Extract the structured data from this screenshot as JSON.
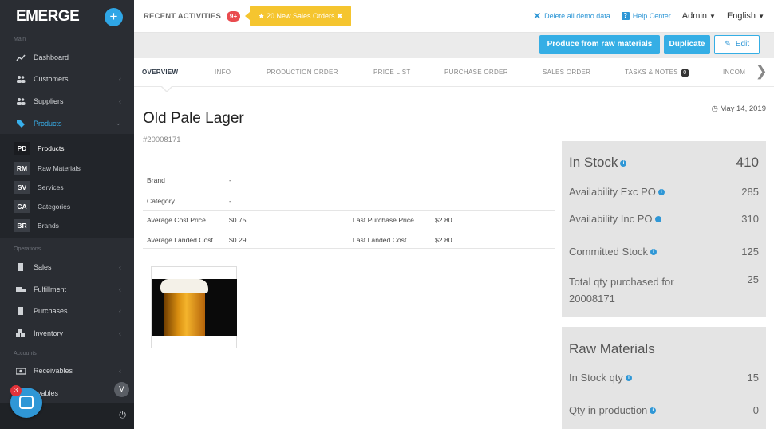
{
  "sidebar": {
    "logo": "EMERGE",
    "add_symbol": "+",
    "section_main": "Main",
    "section_operations": "Operations",
    "section_accounts": "Accounts",
    "items": [
      {
        "label": "Dashboard",
        "icon": "chart-icon"
      },
      {
        "label": "Customers",
        "icon": "users-icon"
      },
      {
        "label": "Suppliers",
        "icon": "users-icon"
      },
      {
        "label": "Products",
        "icon": "tag-icon"
      }
    ],
    "product_sub": [
      {
        "abbr": "PD",
        "label": "Products"
      },
      {
        "abbr": "RM",
        "label": "Raw Materials"
      },
      {
        "abbr": "SV",
        "label": "Services"
      },
      {
        "abbr": "CA",
        "label": "Categories"
      },
      {
        "abbr": "BR",
        "label": "Brands"
      }
    ],
    "ops_items": [
      {
        "label": "Sales"
      },
      {
        "label": "Fulfillment"
      },
      {
        "label": "Purchases"
      },
      {
        "label": "Inventory"
      }
    ],
    "acct_items": [
      {
        "label": "Receivables"
      },
      {
        "label": "ayables"
      }
    ],
    "chat_badge": "3",
    "collapse_symbol": "V"
  },
  "topbar": {
    "recent_label": "RECENT ACTIVITIES",
    "recent_badge": "9+",
    "alert_label": "20 New Sales Orders",
    "delete_demo": "Delete all demo data",
    "help": "Help Center",
    "user": "Admin",
    "language": "English"
  },
  "actions": {
    "produce": "Produce from raw materials",
    "duplicate": "Duplicate",
    "edit": "Edit"
  },
  "tabs": [
    "OVERVIEW",
    "INFO",
    "PRODUCTION ORDER",
    "PRICE LIST",
    "PURCHASE ORDER",
    "SALES ORDER",
    "TASKS & NOTES",
    "INCOM"
  ],
  "tasks_count": "0",
  "product": {
    "date": "May 14, 2019",
    "name": "Old Pale Lager",
    "sku": "#20008171"
  },
  "details": {
    "brand_label": "Brand",
    "brand_value": "-",
    "category_label": "Category",
    "category_value": "-",
    "avg_cost_label": "Average Cost Price",
    "avg_cost_value": "$0.75",
    "last_purchase_label": "Last Purchase Price",
    "last_purchase_value": "$2.80",
    "avg_landed_label": "Average Landed Cost",
    "avg_landed_value": "$0.29",
    "last_landed_label": "Last Landed Cost",
    "last_landed_value": "$2.80"
  },
  "stock": {
    "in_stock_label": "In Stock",
    "in_stock_value": "410",
    "avail_exc_label": "Availability Exc PO",
    "avail_exc_value": "285",
    "avail_inc_label": "Availability Inc PO",
    "avail_inc_value": "310",
    "committed_label": "Committed Stock",
    "committed_value": "125",
    "total_label_1": "Total qty purchased for",
    "total_label_2": "20008171",
    "total_value": "25"
  },
  "raw": {
    "title": "Raw Materials",
    "in_stock_label": "In Stock qty",
    "in_stock_value": "15",
    "in_prod_label": "Qty in production",
    "in_prod_value": "0"
  }
}
